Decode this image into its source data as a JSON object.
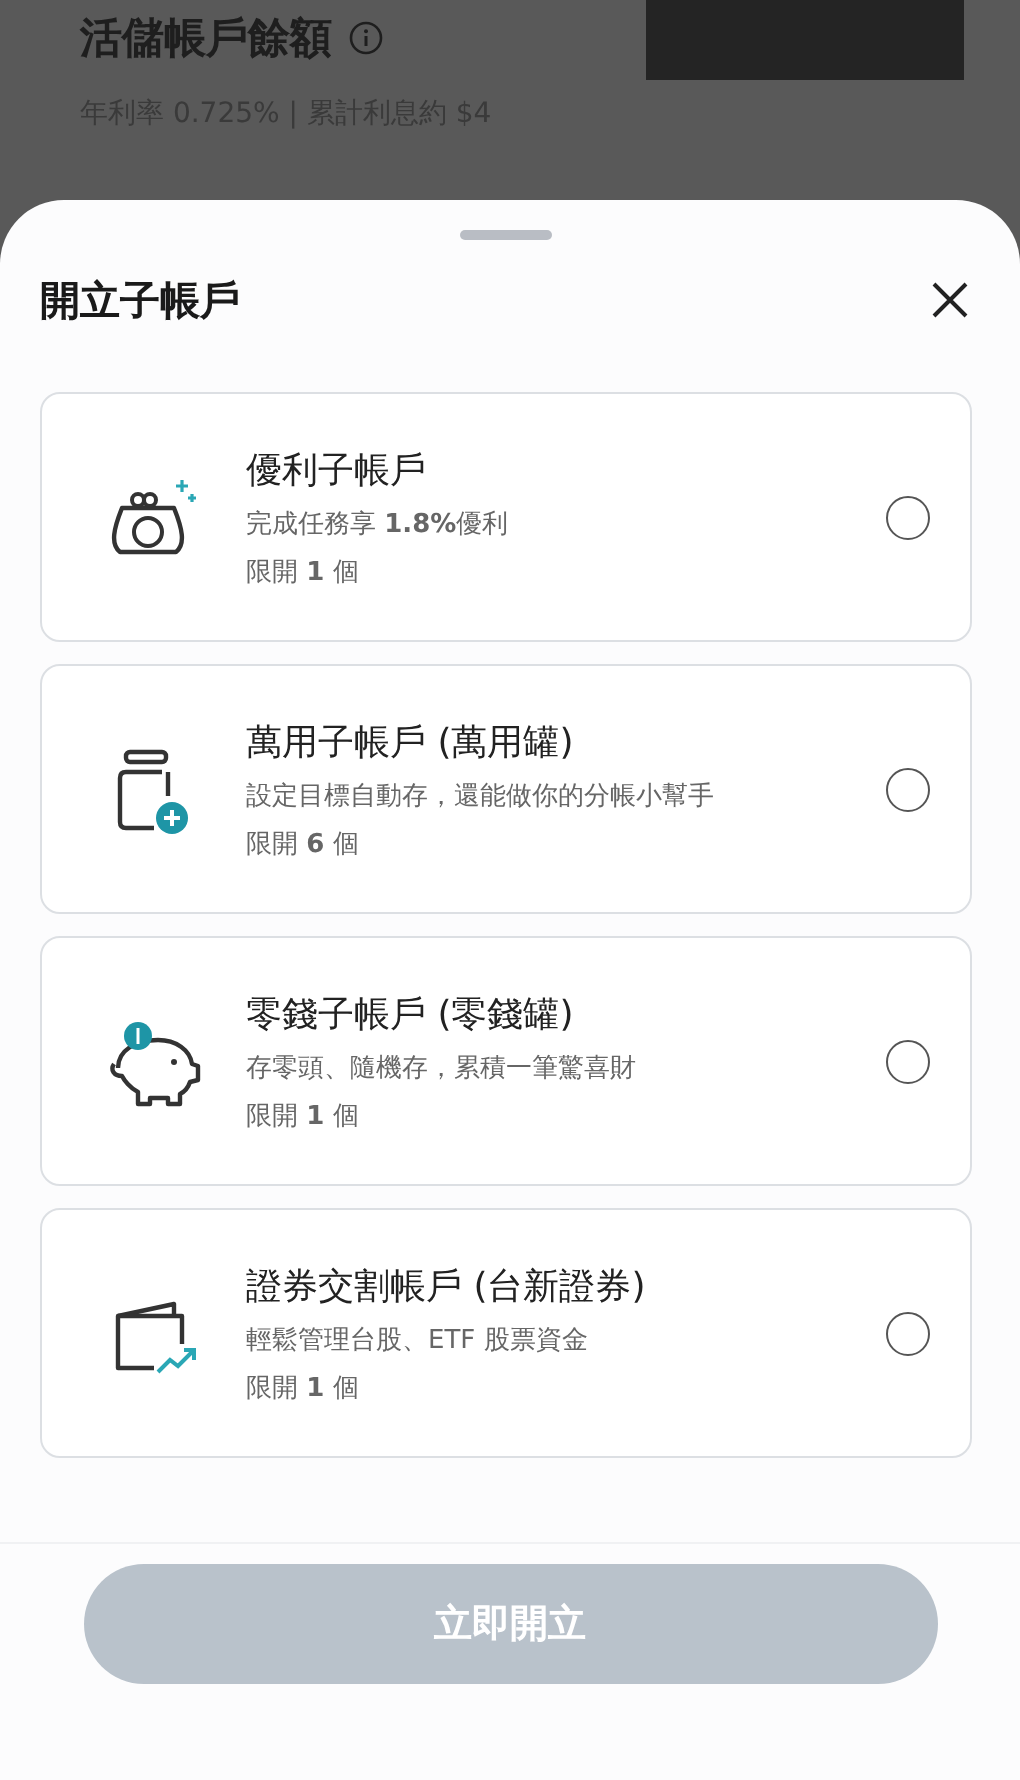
{
  "background": {
    "title": "活儲帳戶餘額",
    "subtitle": "年利率 0.725% | 累計利息約 $4"
  },
  "sheet": {
    "title": "開立子帳戶",
    "options": [
      {
        "kind": "purse",
        "name": "優利子帳戶",
        "description": "完成任務享 **1.8%**優利",
        "limit": "限開 **1** 個",
        "selected": false
      },
      {
        "kind": "jar",
        "name": "萬用子帳戶 (萬用罐)",
        "description": "設定目標自動存，還能做你的分帳小幫手",
        "limit": "限開 **6** 個",
        "selected": false
      },
      {
        "kind": "piggy",
        "name": "零錢子帳戶 (零錢罐)",
        "description": "存零頭、隨機存，累積一筆驚喜財",
        "limit": "限開 **1** 個",
        "selected": false
      },
      {
        "kind": "wallet",
        "name": "證券交割帳戶 (台新證券)",
        "description": "輕鬆管理台股、ETF 股票資金",
        "limit": "限開 **1** 個",
        "selected": false
      }
    ],
    "button": {
      "label": "立即開立",
      "disabled": true
    }
  }
}
